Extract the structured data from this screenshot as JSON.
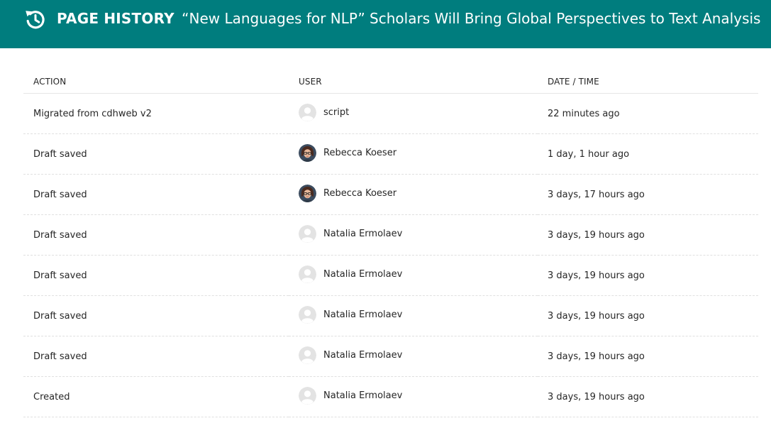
{
  "header": {
    "label": "PAGE HISTORY",
    "page_title": "“New Languages for NLP” Scholars Will Bring Global Perspectives to Text Analysis",
    "icon": "history-icon"
  },
  "table": {
    "columns": [
      "ACTION",
      "USER",
      "DATE / TIME"
    ],
    "rows": [
      {
        "action": "Migrated from cdhweb v2",
        "user": "script",
        "avatar": "default-avatar",
        "date": "22 minutes ago"
      },
      {
        "action": "Draft saved",
        "user": "Rebecca Koeser",
        "avatar": "photo-avatar",
        "date": "1 day, 1 hour ago"
      },
      {
        "action": "Draft saved",
        "user": "Rebecca Koeser",
        "avatar": "photo-avatar",
        "date": "3 days, 17 hours ago"
      },
      {
        "action": "Draft saved",
        "user": "Natalia Ermolaev",
        "avatar": "default-avatar",
        "date": "3 days, 19 hours ago"
      },
      {
        "action": "Draft saved",
        "user": "Natalia Ermolaev",
        "avatar": "default-avatar",
        "date": "3 days, 19 hours ago"
      },
      {
        "action": "Draft saved",
        "user": "Natalia Ermolaev",
        "avatar": "default-avatar",
        "date": "3 days, 19 hours ago"
      },
      {
        "action": "Draft saved",
        "user": "Natalia Ermolaev",
        "avatar": "default-avatar",
        "date": "3 days, 19 hours ago"
      },
      {
        "action": "Created",
        "user": "Natalia Ermolaev",
        "avatar": "default-avatar",
        "date": "3 days, 19 hours ago"
      }
    ]
  },
  "colors": {
    "header_bg": "#007d7e",
    "header_text": "#ffffff",
    "text": "#262626",
    "row_divider": "#e0e0e0"
  }
}
